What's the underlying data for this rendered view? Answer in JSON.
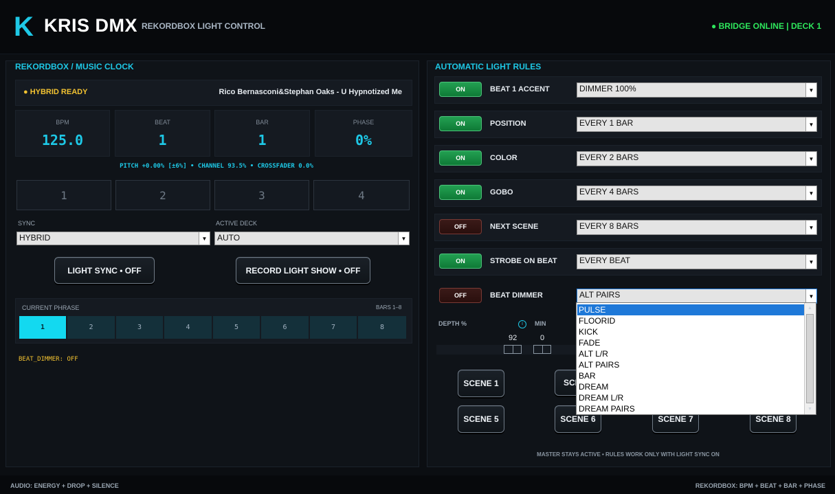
{
  "header": {
    "logo_letter": "K",
    "title": "KRIS DMX",
    "subtitle": "REKORDBOX LIGHT CONTROL",
    "status": "● BRIDGE ONLINE  |  DECK 1",
    "status_color": "#2ee65c",
    "accent_color": "#1ec8e6"
  },
  "left": {
    "title": "REKORDBOX / MUSIC CLOCK",
    "hybrid_status": "● HYBRID READY",
    "track": "Rico Bernasconi&Stephan Oaks - U Hypnotized Me",
    "stats": [
      {
        "label": "BPM",
        "value": "125.0"
      },
      {
        "label": "BEAT",
        "value": "1"
      },
      {
        "label": "BAR",
        "value": "1"
      },
      {
        "label": "PHASE",
        "value": "0%"
      }
    ],
    "info_line": "PITCH +0.00% [±6%]   •   CHANNEL 93.5%   •   CROSSFADER 0.0%",
    "decks": [
      "1",
      "2",
      "3",
      "4"
    ],
    "sync_label": "SYNC",
    "sync_value": "HYBRID",
    "active_deck_label": "ACTIVE DECK",
    "active_deck_value": "AUTO",
    "light_sync_button": "LIGHT SYNC  •  OFF",
    "record_button": "RECORD LIGHT SHOW  •  OFF",
    "phrase_label": "CURRENT PHRASE",
    "phrase_bars": "BARS 1–8",
    "phrase_cells": [
      "1",
      "2",
      "3",
      "4",
      "5",
      "6",
      "7",
      "8"
    ],
    "phrase_active": 1,
    "beat_dimmer_status": "BEAT_DIMMER: OFF",
    "beat_dimmer_color": "#f2c231"
  },
  "right": {
    "title": "AUTOMATIC LIGHT RULES",
    "rules": [
      {
        "toggle": "ON",
        "name": "BEAT 1 ACCENT",
        "value": "DIMMER 100%"
      },
      {
        "toggle": "ON",
        "name": "POSITION",
        "value": "EVERY 1 BAR"
      },
      {
        "toggle": "ON",
        "name": "COLOR",
        "value": "EVERY 2 BARS"
      },
      {
        "toggle": "ON",
        "name": "GOBO",
        "value": "EVERY 4 BARS"
      },
      {
        "toggle": "OFF",
        "name": "NEXT SCENE",
        "value": "EVERY 8 BARS"
      },
      {
        "toggle": "ON",
        "name": "STROBE ON BEAT",
        "value": "EVERY BEAT"
      },
      {
        "toggle": "OFF",
        "name": "BEAT DIMMER",
        "value": "ALT PAIRS"
      }
    ],
    "depth_label": "DEPTH %",
    "min_label": "MIN",
    "depth_value": "92",
    "min_value": "0",
    "info_icon": "info-icon",
    "dropdown_options": [
      "PULSE",
      "FLOORID",
      "KICK",
      "FADE",
      "ALT L/R",
      "ALT PAIRS",
      "BAR",
      "DREAM",
      "DREAM L/R",
      "DREAM PAIRS"
    ],
    "dropdown_selected": "PULSE",
    "scenes_row1": [
      "SCENE 1",
      "SCE"
    ],
    "scenes_row2": [
      "SCENE 5",
      "SCENE 6",
      "SCENE 7",
      "SCENE 8"
    ],
    "footer_note": "MASTER STAYS ACTIVE • RULES WORK ONLY WITH LIGHT SYNC ON"
  },
  "footer": {
    "left": "AUDIO: ENERGY + DROP + SILENCE",
    "right": "REKORDBOX: BPM + BEAT + BAR + PHASE"
  }
}
